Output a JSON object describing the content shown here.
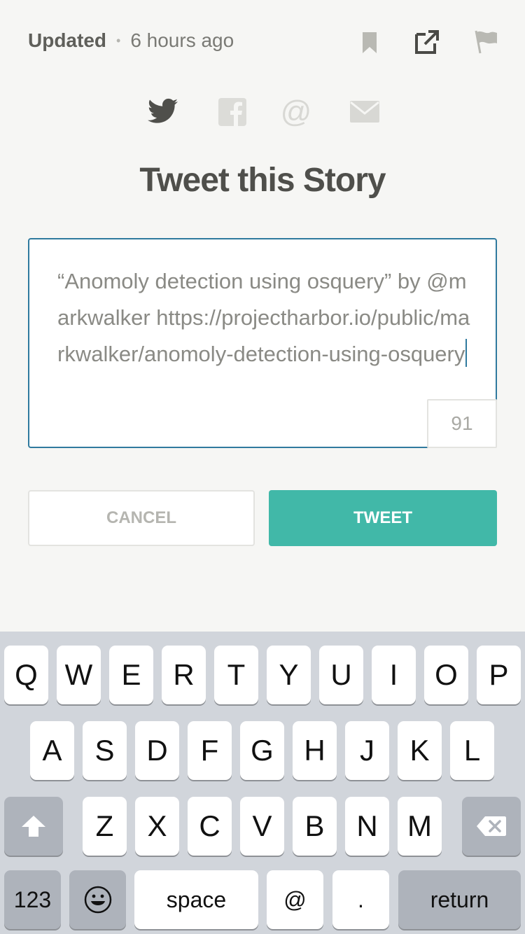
{
  "header": {
    "updated_label": "Updated",
    "separator": "•",
    "time": "6 hours ago",
    "icons": [
      "bookmark-icon",
      "external-link-icon",
      "flag-icon"
    ]
  },
  "share": {
    "icons": [
      "twitter-icon",
      "facebook-icon",
      "at-mention-icon",
      "email-icon"
    ],
    "title": "Tweet this Story"
  },
  "tweet": {
    "text": "“Anomoly detection using osquery” by @markwalker https://projectharbor.io/public/markwalker/anomoly-detection-using-osquery",
    "char_count": "91"
  },
  "buttons": {
    "cancel": "CANCEL",
    "tweet": "TWEET"
  },
  "keyboard": {
    "row1": [
      "Q",
      "W",
      "E",
      "R",
      "T",
      "Y",
      "U",
      "I",
      "O",
      "P"
    ],
    "row2": [
      "A",
      "S",
      "D",
      "F",
      "G",
      "H",
      "J",
      "K",
      "L"
    ],
    "row3": [
      "Z",
      "X",
      "C",
      "V",
      "B",
      "N",
      "M"
    ],
    "numbers_key": "123",
    "space_key": "space",
    "at_key": "@",
    "period_key": ".",
    "return_key": "return"
  },
  "colors": {
    "accent": "#41b8a8",
    "focus_border": "#2f7a9e",
    "background": "#f6f6f4",
    "keyboard_bg": "#d1d5db"
  }
}
